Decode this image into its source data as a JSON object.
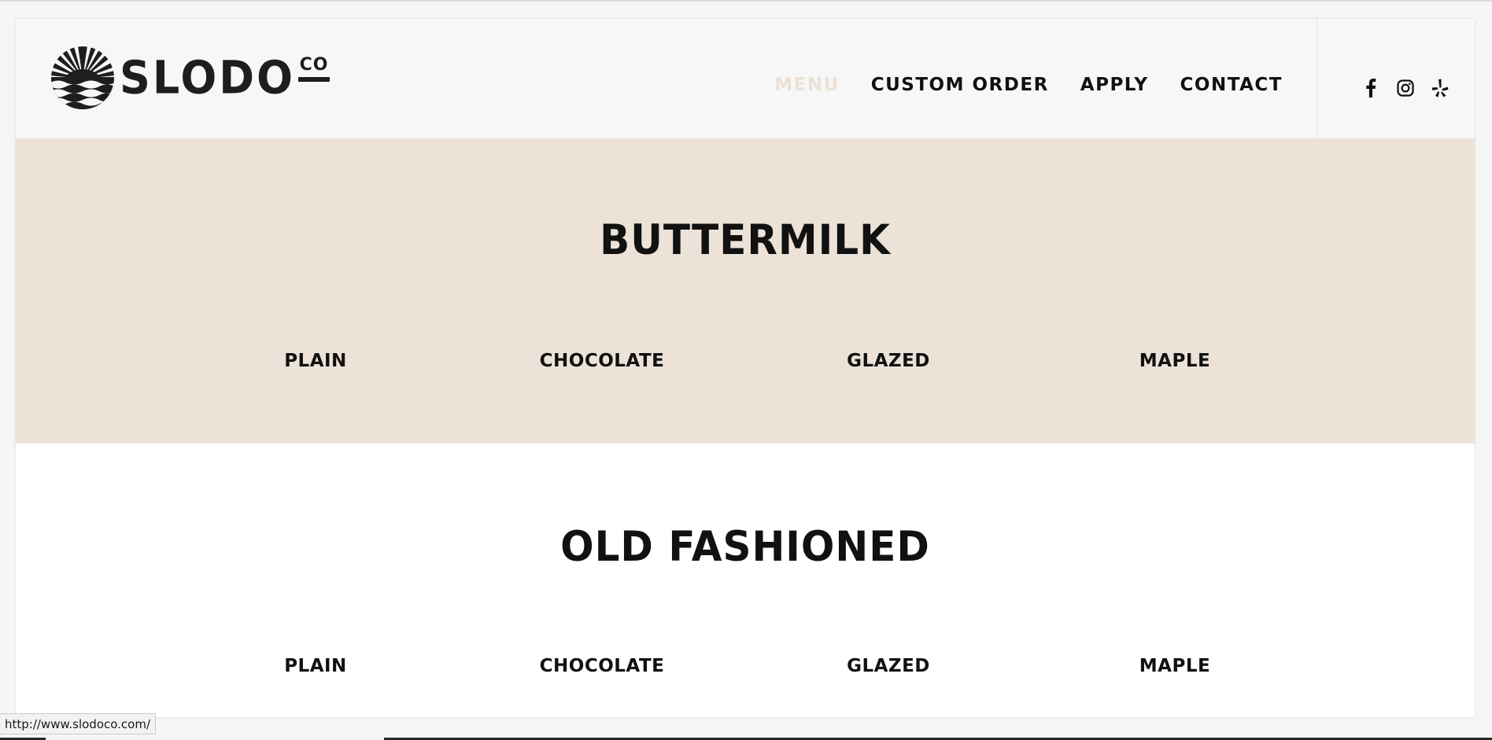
{
  "brand": {
    "name": "SLODO",
    "suffix": "CO"
  },
  "nav": {
    "items": [
      {
        "label": "MENU",
        "active": true
      },
      {
        "label": "CUSTOM ORDER",
        "active": false
      },
      {
        "label": "APPLY",
        "active": false
      },
      {
        "label": "CONTACT",
        "active": false
      }
    ]
  },
  "social": {
    "icons": [
      "facebook-icon",
      "instagram-icon",
      "yelp-icon"
    ]
  },
  "sections": [
    {
      "title": "BUTTERMILK",
      "flavors": [
        "PLAIN",
        "CHOCOLATE",
        "GLAZED",
        "MAPLE"
      ]
    },
    {
      "title": "OLD FASHIONED",
      "flavors": [
        "PLAIN",
        "CHOCOLATE",
        "GLAZED",
        "MAPLE"
      ]
    }
  ],
  "status_bar": {
    "url": "http://www.slodoco.com/"
  },
  "colors": {
    "accent_beige": "#ece2d8",
    "text_dark": "#111111",
    "active_nav": "#ece1d6"
  }
}
